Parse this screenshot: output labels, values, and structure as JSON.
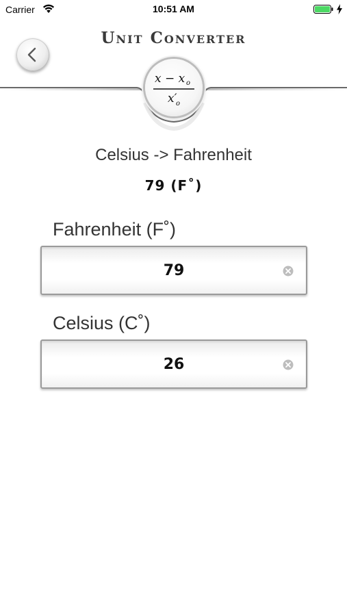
{
  "status_bar": {
    "carrier": "Carrier",
    "time": "10:51 AM",
    "icons": [
      "wifi-icon",
      "battery-icon",
      "charging-bolt-icon"
    ]
  },
  "header": {
    "title": "Unit Converter",
    "back_icon": "chevron-left-icon",
    "formula": {
      "numerator": "x − x",
      "numerator_sub": "o",
      "denominator": "x′",
      "denominator_sub": "o"
    }
  },
  "conversion": {
    "label": "Celsius -> Fahrenheit",
    "result": "79 (F˚)"
  },
  "fields": [
    {
      "label": "Fahrenheit (F˚)",
      "value": "79",
      "clear_icon": "clear-circle-icon"
    },
    {
      "label": "Celsius (C˚)",
      "value": "26",
      "clear_icon": "clear-circle-icon"
    }
  ],
  "colors": {
    "background": "#ffffff",
    "text": "#333333",
    "field_border": "#9a9a9a",
    "battery": "#4cd964"
  }
}
